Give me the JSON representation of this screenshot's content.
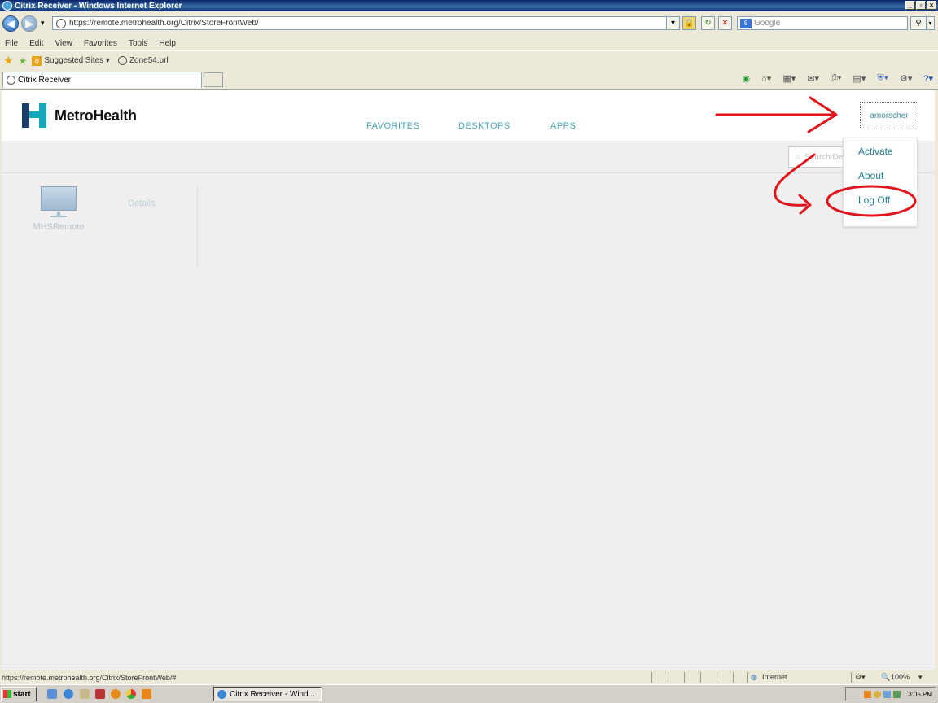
{
  "window": {
    "title": "Citrix Receiver - Windows Internet Explorer"
  },
  "browser": {
    "url": "https://remote.metrohealth.org/Citrix/StoreFrontWeb/",
    "search_placeholder": "Google",
    "menu": [
      "File",
      "Edit",
      "View",
      "Favorites",
      "Tools",
      "Help"
    ],
    "favorites": {
      "suggested": "Suggested Sites ▾",
      "zone": "Zone54.url"
    },
    "tab_title": "Citrix Receiver"
  },
  "page": {
    "brand": "MetroHealth",
    "nav": [
      "FAVORITES",
      "DESKTOPS",
      "APPS"
    ],
    "user": "amorscher",
    "search_placeholder": "Search De",
    "menu": {
      "activate": "Activate",
      "about": "About",
      "logoff": "Log Off"
    },
    "app": {
      "name": "MHSRemote",
      "details": "Details"
    }
  },
  "status": {
    "url": "https://remote.metrohealth.org/Citrix/StoreFrontWeb/#",
    "zone": "Internet",
    "zoom": "100%"
  },
  "taskbar": {
    "start": "start",
    "task": "Citrix Receiver - Wind...",
    "clock": "3:05 PM"
  },
  "annotation_color": "#e0161e"
}
